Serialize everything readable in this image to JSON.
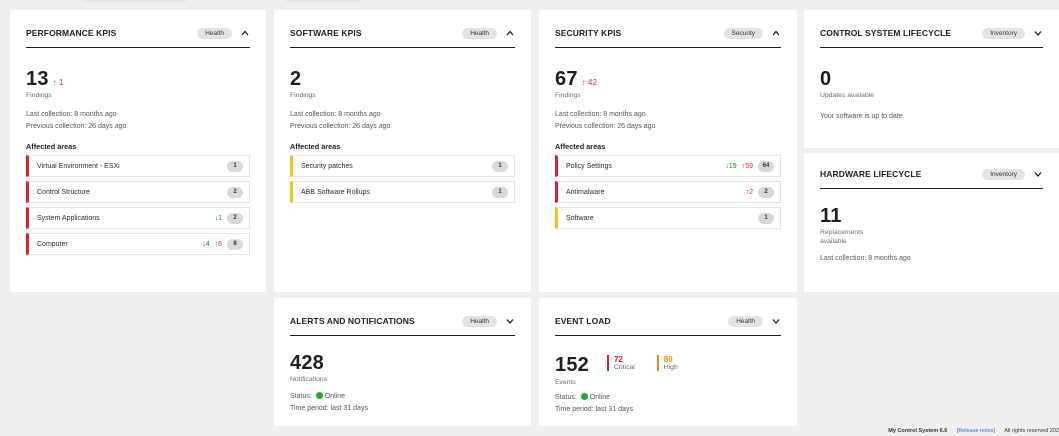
{
  "performance": {
    "title": "PERFORMANCE KPIS",
    "badge": "Health",
    "count": "13",
    "trend": "↑ 1",
    "sub": "Findings",
    "last": "Last collection: 8 months ago",
    "prev": "Previous collection: 26 days ago",
    "areas_title": "Affected areas",
    "areas": [
      {
        "label": "Virtual Environment - ESXi",
        "down": "",
        "up": "",
        "count": "1"
      },
      {
        "label": "Control Structure",
        "down": "",
        "up": "",
        "count": "2"
      },
      {
        "label": "System Applications",
        "down": "↓1",
        "up": "",
        "count": "2"
      },
      {
        "label": "Computer",
        "down": "↓4",
        "up": "↑6",
        "count": "8"
      }
    ]
  },
  "software": {
    "title": "SOFTWARE KPIS",
    "badge": "Health",
    "count": "2",
    "sub": "Findings",
    "last": "Last collection: 8 months ago",
    "prev": "Previous collection: 26 days ago",
    "areas_title": "Affected areas",
    "areas": [
      {
        "label": "Security patches",
        "count": "1"
      },
      {
        "label": "ABB Software Rollups",
        "count": "1"
      }
    ]
  },
  "security": {
    "title": "SECURITY KPIS",
    "badge": "Security",
    "count": "67",
    "trend": "↑ 42",
    "sub": "Findings",
    "last": "Last collection: 8 months ago",
    "prev": "Previous collection: 26 days ago",
    "areas_title": "Affected areas",
    "areas": [
      {
        "label": "Policy Settings",
        "down": "↓19",
        "up": "↑59",
        "count": "64"
      },
      {
        "label": "Antimalware",
        "down": "",
        "up": "↑2",
        "count": "2"
      },
      {
        "label": "Software",
        "down": "",
        "up": "",
        "count": "1"
      }
    ]
  },
  "lifecycle": {
    "title": "CONTROL SYSTEM LIFECYCLE",
    "badge": "Inventory",
    "count": "0",
    "sub": "Updates available",
    "note": "Your software is up to date"
  },
  "hardware": {
    "title": "HARDWARE LIFECYCLE",
    "badge": "Inventory",
    "count": "11",
    "sub1": "Replacements",
    "sub2": "available",
    "last": "Last collection: 8 months ago"
  },
  "alerts": {
    "title": "ALERTS AND NOTIFICATIONS",
    "badge": "Health",
    "count": "428",
    "sub": "Notifications",
    "status_label": "Status:",
    "status": "Online",
    "period": "Time period: last 31 days"
  },
  "events": {
    "title": "EVENT LOAD",
    "badge": "Health",
    "count": "152",
    "sub": "Events",
    "critical_count": "72",
    "critical_label": "Critical",
    "high_count": "80",
    "high_label": "High",
    "status_label": "Status:",
    "status": "Online",
    "period": "Time period: last 31 days"
  },
  "footer": {
    "product": "My Control System 6.6",
    "release": "[Release notes]",
    "rights": "All rights reserved 202"
  },
  "colors": {
    "critical": "#e0202e",
    "high": "#f08c00",
    "online": "#21a93a",
    "trend_down": "#1b8a2b"
  },
  "icons": {
    "collapse": "chevron-up-icon",
    "expand": "chevron-down-icon"
  }
}
